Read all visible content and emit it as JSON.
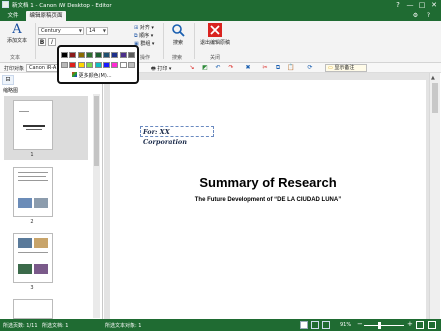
{
  "titlebar": {
    "title": "新文档 1 - Canon iW Desktop - Editor",
    "help_glyph": "?",
    "min_glyph": "—",
    "max_glyph": "□",
    "close_glyph": "✕"
  },
  "tabs": {
    "file": "文件",
    "active": "编辑原稿页面"
  },
  "ribbon": {
    "add_text": "添加文本",
    "font_name": "Century",
    "font_size": "14",
    "bold": "B",
    "italic": "I",
    "group_text": "文本",
    "arrange_label": "顺序",
    "group_label": "群组",
    "group_edit": "操作",
    "search_label": "搜索",
    "group_search": "搜索",
    "exit_label": "退出编辑原稿",
    "group_close": "关闭",
    "arrange_top": "对齐"
  },
  "toolbar2": {
    "print_target": "打印对象",
    "printer": "Canon iR-A",
    "print_label": "打印",
    "show_annotation": "显示备注"
  },
  "color_popup": {
    "more_colors": "更多颜色(M)...",
    "row1": [
      "#000000",
      "#8b1a1a",
      "#8a6a00",
      "#2f6f2f",
      "#1f5f2f",
      "#1f4f6f",
      "#1c2f8a",
      "#4b2f8a",
      "#5a5a5a"
    ],
    "row2": [
      "#b8b8b8",
      "#e0201c",
      "#ffd400",
      "#7cd84a",
      "#13c0c0",
      "#1a1aff",
      "#ff2ad4",
      "#ffffff",
      "#bdbdbd"
    ]
  },
  "leftpanel": {
    "tab_label": "缩略图",
    "page_numbers": [
      "1",
      "2",
      "3"
    ]
  },
  "document": {
    "annotation_text": "For: XX Corporation",
    "title": "Summary of Research",
    "subtitle": "The Future Development of “DE LA CIUDAD LUNA”"
  },
  "statusbar": {
    "pages": "所选页数: 1/11",
    "docs": "所选文档: 1",
    "objects": "所选文本对象: 1",
    "zoom": "91%"
  },
  "colors": {
    "brand_green": "#1f6b32",
    "accent_red": "#d9231f"
  }
}
